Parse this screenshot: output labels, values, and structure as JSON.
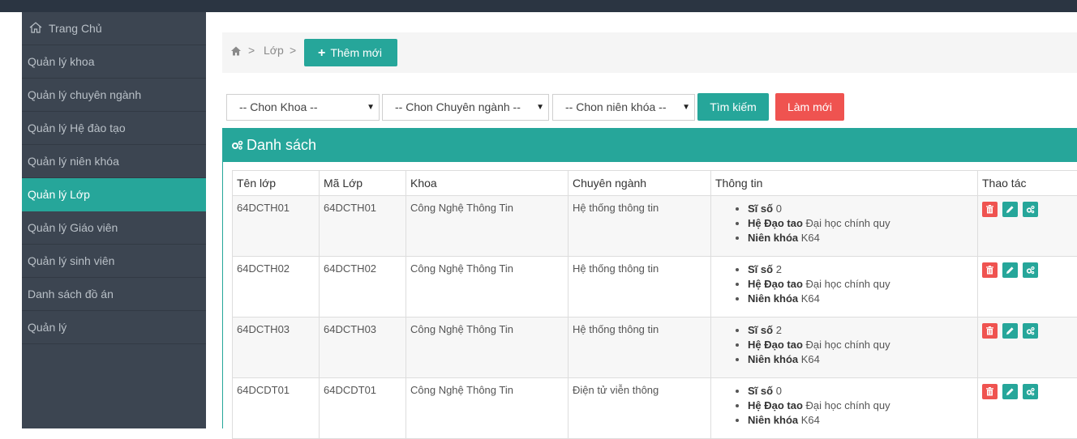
{
  "sidebar": {
    "items": [
      {
        "label": "Trang Chủ",
        "icon": "home-icon"
      },
      {
        "label": "Quản lý khoa"
      },
      {
        "label": "Quản lý chuyên ngành"
      },
      {
        "label": "Quản lý Hệ đào tạo"
      },
      {
        "label": "Quản lý niên khóa"
      },
      {
        "label": "Quản lý Lớp",
        "active": true
      },
      {
        "label": "Quản lý Giáo viên"
      },
      {
        "label": "Quản lý sinh viên"
      },
      {
        "label": "Danh sách đồ án"
      },
      {
        "label": "Quản lý"
      }
    ]
  },
  "breadcrumb": {
    "sep": ">",
    "current": "Lớp",
    "add_button": "Thêm mới"
  },
  "filters": {
    "khoa": "-- Chon Khoa --",
    "chuyen_nganh": "-- Chon Chuyên ngành --",
    "nien_khoa": "-- Chon niên khóa --",
    "search_button": "Tìm kiếm",
    "reset_button": "Làm mới",
    "caret": "▼"
  },
  "panel": {
    "title": "Danh sách"
  },
  "table": {
    "headers": [
      "Tên lớp",
      "Mã Lớp",
      "Khoa",
      "Chuyên ngành",
      "Thông tin",
      "Thao tác"
    ],
    "info_labels": {
      "si_so": "Sĩ số",
      "he_dao_tao": "Hệ Đạo tao",
      "nien_khoa": "Niên khóa"
    },
    "rows": [
      {
        "ten_lop": "64DCTH01",
        "ma_lop": "64DCTH01",
        "khoa": "Công Nghệ Thông Tin",
        "chuyen_nganh": "Hệ thống thông tin",
        "si_so": "0",
        "he_dao_tao": "Đại học chính quy",
        "nien_khoa": "K64"
      },
      {
        "ten_lop": "64DCTH02",
        "ma_lop": "64DCTH02",
        "khoa": "Công Nghệ Thông Tin",
        "chuyen_nganh": "Hệ thống thông tin",
        "si_so": "2",
        "he_dao_tao": "Đại học chính quy",
        "nien_khoa": "K64"
      },
      {
        "ten_lop": "64DCTH03",
        "ma_lop": "64DCTH03",
        "khoa": "Công Nghệ Thông Tin",
        "chuyen_nganh": "Hệ thống thông tin",
        "si_so": "2",
        "he_dao_tao": "Đại học chính quy",
        "nien_khoa": "K64"
      },
      {
        "ten_lop": "64DCDT01",
        "ma_lop": "64DCDT01",
        "khoa": "Công Nghệ Thông Tin",
        "chuyen_nganh": "Điện tử viễn thông",
        "si_so": "0",
        "he_dao_tao": "Đại học chính quy",
        "nien_khoa": "K64"
      }
    ]
  },
  "colors": {
    "primary": "#26a69a",
    "danger": "#ef5350",
    "sidebar_bg": "#3c4551",
    "topbar_bg": "#2b3542"
  }
}
